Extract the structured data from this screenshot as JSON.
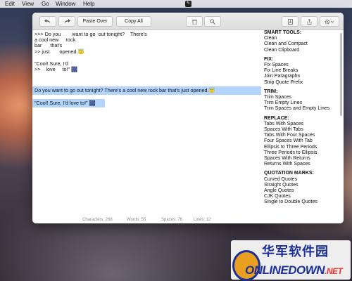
{
  "menubar": {
    "items": [
      "Edit",
      "View",
      "Go",
      "Window",
      "Help"
    ]
  },
  "toolbar": {
    "paste_over_label": "Paste Over",
    "copy_all_label": "Copy All"
  },
  "editor": {
    "paragraphs": [
      ">>> Do you        want to go  out tonight?    There's\na cool new     rock\nbar      that's\n>> just       opened.😇",
      "\"Cool! Sure, I'd\n>>    love     to!\" 🎆",
      "Do you want to go out tonight? There's a cool new rock bar that's just opened.😇",
      "\"Cool! Sure, I'd love to!\" 🎆"
    ]
  },
  "sidebar": {
    "sections": [
      {
        "heading": "SMART TOOLS:",
        "items": [
          "Clean",
          "Clean and Compact",
          "Clean Clipboard"
        ]
      },
      {
        "heading": "FIX:",
        "items": [
          "Fix Spaces",
          "Fix Line Breaks",
          "Join Paragraphs",
          "Strip Quote Prefix"
        ]
      },
      {
        "heading": "TRIM:",
        "items": [
          "Trim Spaces",
          "Trim Empty Lines",
          "Trim Spaces and Empty Lines"
        ]
      },
      {
        "heading": "REPLACE:",
        "items": [
          "Tabs With Spaces",
          "Spaces With Tabs",
          "Tabs With Four Spaces",
          "Four Spaces With Tab",
          "Ellipsis to Three Periods",
          "Three Periods to Ellipsis",
          "Spaces With Returns",
          "Returns With Spaces"
        ]
      },
      {
        "heading": "QUOTATION MARKS:",
        "items": [
          "Curved Quotes",
          "Straight Quotes",
          "Angle Quotes",
          "CJK Quotes",
          "Single to Double Quotes"
        ]
      }
    ]
  },
  "statusbar": {
    "characters": "Characters: 268",
    "words": "Words: 55",
    "spaces": "Spaces: 76",
    "lines": "Lines: 12"
  },
  "watermark": {
    "chinese": "华军软件园",
    "english": "ONLINEDOWN",
    "suffix": ".NET"
  },
  "icons": {
    "status": "app-status-icon",
    "undo": "undo-icon",
    "redo": "redo-icon",
    "trash": "trash-icon",
    "search": "search-icon",
    "import": "import-icon",
    "share": "share-icon",
    "gear": "gear-icon"
  }
}
